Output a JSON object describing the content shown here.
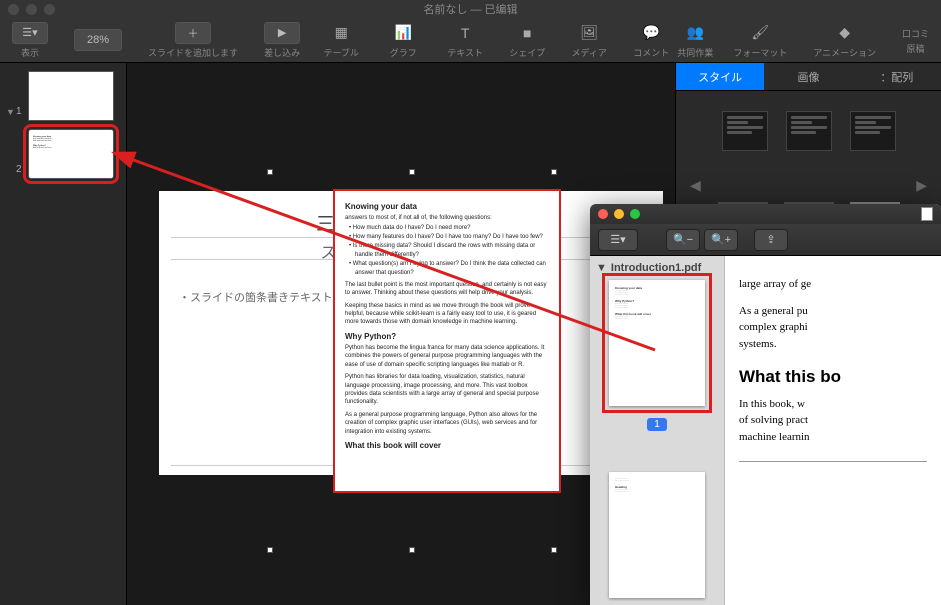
{
  "window": {
    "title": "名前なし — 已编辑"
  },
  "toolbar": {
    "view": "表示",
    "zoom": "28%",
    "add_slide": "スライドを追加します",
    "play": "差し込み",
    "table": "テーブル",
    "chart": "グラフ",
    "text": "テキスト",
    "shape": "シェイプ",
    "media": "メディア",
    "comment": "コメント",
    "collab": "共同作業",
    "format": "フォーマット",
    "animate": "アニメーション",
    "doc": "口コミ",
    "doc_sub": "原稿"
  },
  "slides": {
    "thumb1_num": "1",
    "thumb2_num": "2"
  },
  "slide_edit": {
    "title_placeholder": "三スライドのタイトル",
    "subtitle_placeholder": "スライドのサブタイトルr",
    "bullet_placeholder": "・スライドの箇条書きテキスト",
    "doc": {
      "heading1": "Knowing your data",
      "p1": "answers to most of, if not all of, the following questions:",
      "b1": "• How much data do I have? Do I need more?",
      "b2": "• How many features do I have? Do I have too many? Do I have too few?",
      "b3": "• Is there missing data? Should I discard the rows with missing data or handle them differently?",
      "b4": "• What question(s) am I trying to answer? Do I think the data collected can answer that question?",
      "p2": "The last bullet point is the most important question, and certainly is not easy to answer. Thinking about these questions will help drive your analysis.",
      "p3": "Keeping these basics in mind as we move through the book will prove helpful, because while scikit-learn is a fairly easy tool to use, it is geared more towards those with domain knowledge in machine learning.",
      "heading2": "Why Python?",
      "p4": "Python has become the lingua franca for many data science applications. It combines the powers of general purpose programming languages with the ease of use of domain specific scripting languages like matlab or R.",
      "p5": "Python has libraries for data loading, visualization, statistics, natural language processing, image processing, and more. This vast toolbox provides data scientists with a large array of general and special purpose functionality.",
      "p6": "As a general purpose programming language, Python also allows for the creation of complex graphic user interfaces (GUIs), web services and for integration into existing systems.",
      "heading3": "What this book will cover"
    }
  },
  "inspector": {
    "tabs": {
      "style": "スタイル",
      "image": "画像",
      "arrange": "：配列"
    }
  },
  "preview": {
    "filename": "Introduction1.pdf",
    "page1_num": "1",
    "content": {
      "p1": "large array of ge",
      "p2": "As a general pu",
      "p2b": "complex graphi",
      "p2c": "systems.",
      "h1": "What this bo",
      "p3": "In this book, w",
      "p3b": "of solving pract",
      "p3c": "machine learnin"
    }
  }
}
